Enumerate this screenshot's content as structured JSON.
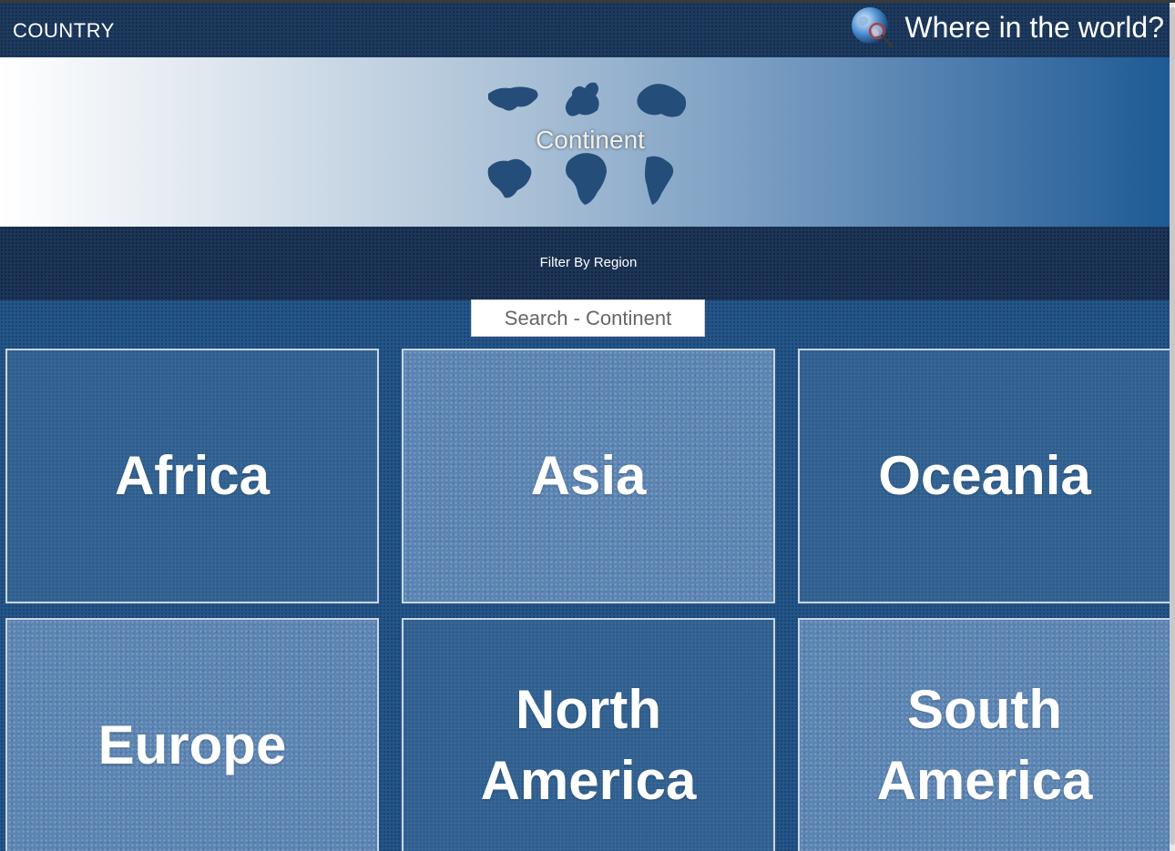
{
  "header": {
    "brand": "COUNTRY",
    "site_title": "Where in the world?",
    "globe_icon": "globe-magnifier-icon"
  },
  "banner": {
    "label": "Continent",
    "art": "world-map-continents"
  },
  "filter": {
    "label": "Filter By Region",
    "search_placeholder": "Search - Continent"
  },
  "continents": [
    {
      "label": "Africa",
      "style": "grid"
    },
    {
      "label": "Asia",
      "style": "paper"
    },
    {
      "label": "Oceania",
      "style": "grid"
    },
    {
      "label": "Europe",
      "style": "paper"
    },
    {
      "label": "North America",
      "style": "grid"
    },
    {
      "label": "South America",
      "style": "paper"
    }
  ],
  "colors": {
    "header_bg": "#1d3a5f",
    "page_bg": "#24568a",
    "card_border": "#c9d6e3"
  }
}
